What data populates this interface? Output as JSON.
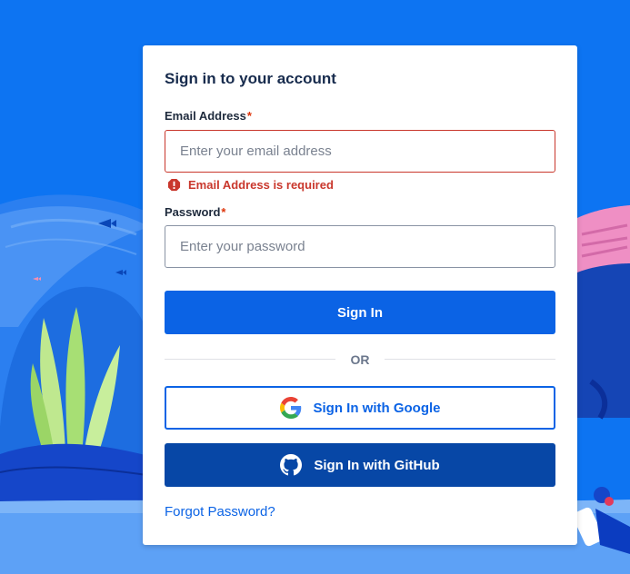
{
  "form": {
    "title": "Sign in to your account",
    "email_label": "Email Address",
    "email_required_mark": "*",
    "email_placeholder": "Enter your email address",
    "email_value": "",
    "email_error": "Email Address is required",
    "password_label": "Password",
    "password_required_mark": "*",
    "password_placeholder": "Enter your password",
    "password_value": "",
    "sign_in_label": "Sign In",
    "or_label": "OR",
    "google_label": "Sign In with Google",
    "github_label": "Sign In with GitHub",
    "forgot_label": "Forgot Password?"
  },
  "icons": {
    "error": "error-icon",
    "google": "google-logo-icon",
    "github": "github-logo-icon"
  },
  "colors": {
    "background": "#0d74f2",
    "primary": "#0b63e5",
    "github_button": "#0747a6",
    "error": "#c9372c"
  }
}
